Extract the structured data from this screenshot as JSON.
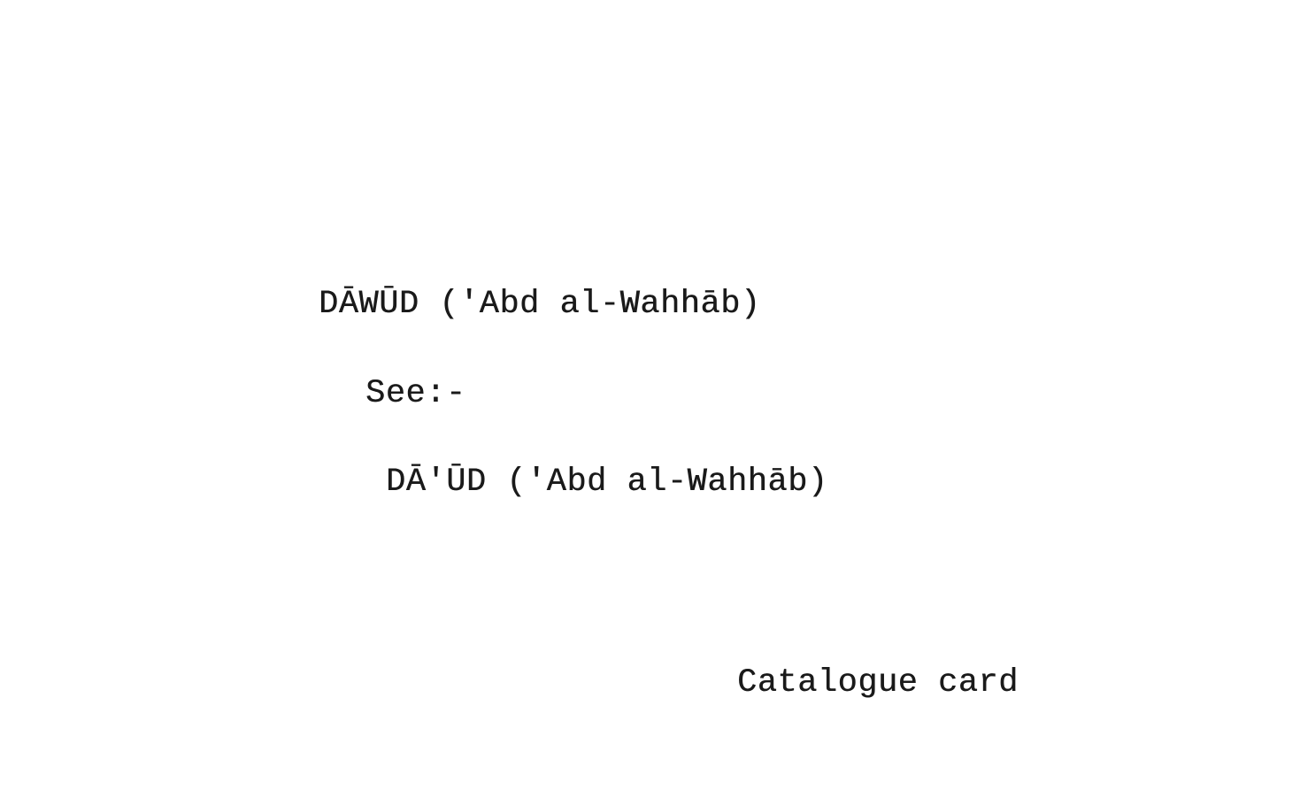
{
  "card": {
    "heading": "DĀWŪD ('Abd al-Wahhāb)",
    "see_label": "See:-",
    "reference": "DĀ'ŪD ('Abd al-Wahhāb)",
    "footer": "Catalogue card"
  },
  "colors": {
    "ink": "#1a1a1a",
    "paper": "#ffffff"
  }
}
